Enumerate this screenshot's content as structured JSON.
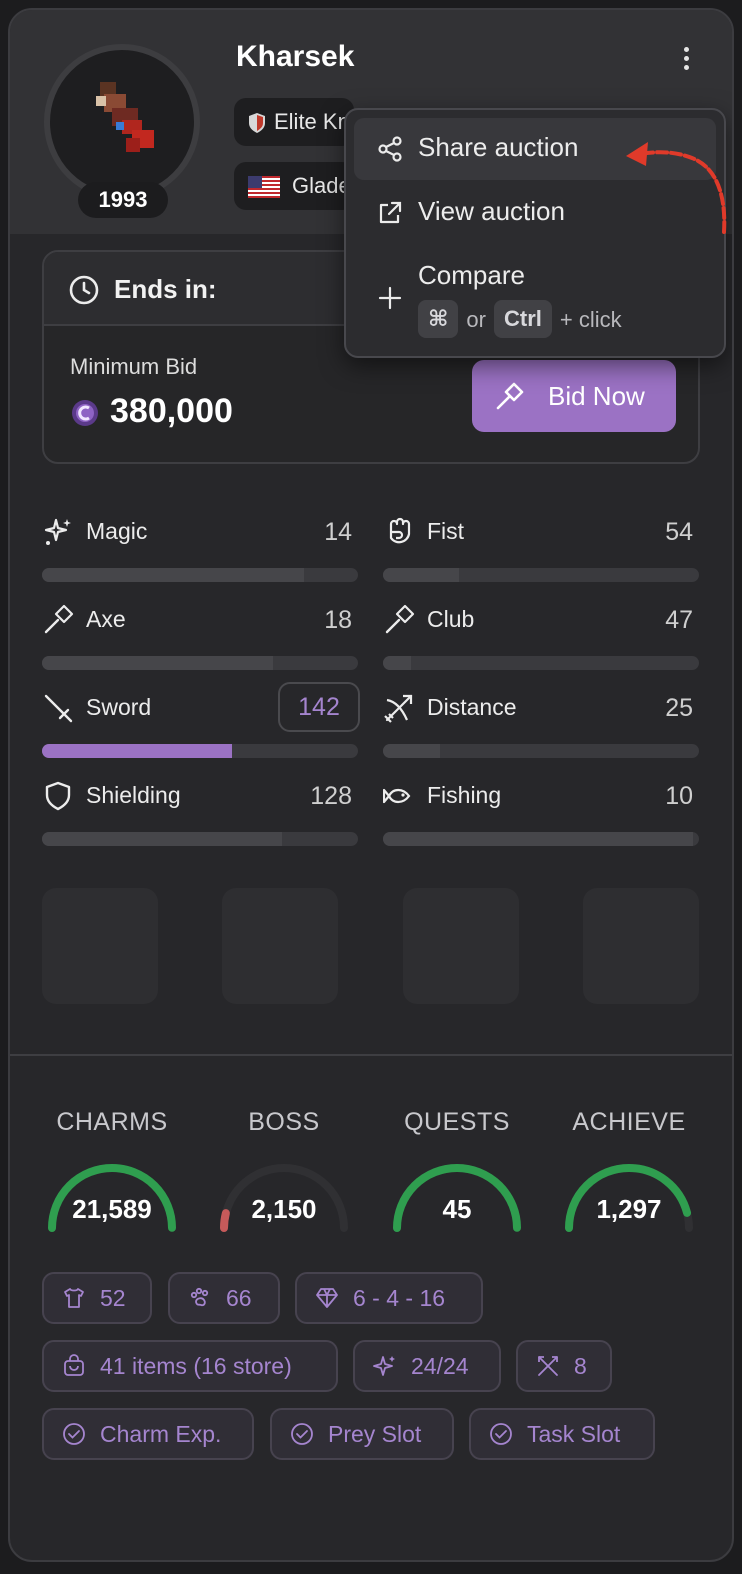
{
  "character": {
    "name": "Kharsek",
    "level": "1993",
    "vocation": "Elite Knight",
    "world": "Gladera",
    "vocation_icon": "shield-icon",
    "flag_icon": "us-flag-icon"
  },
  "menu": {
    "share_label": "Share auction",
    "view_label": "View auction",
    "compare_label": "Compare",
    "compare_hint": {
      "cmd": "⌘",
      "or": "or",
      "ctrl": "Ctrl",
      "click": "+ click"
    }
  },
  "auction": {
    "ends_label": "Ends in:",
    "min_bid_label": "Minimum Bid",
    "min_bid_value": "380,000",
    "bid_button_label": "Bid Now"
  },
  "skills": [
    {
      "name": "Magic",
      "value": "14",
      "progress": 0.83,
      "icon": "sparkles-icon"
    },
    {
      "name": "Fist",
      "value": "54",
      "progress": 0.24,
      "icon": "fist-icon"
    },
    {
      "name": "Axe",
      "value": "18",
      "progress": 0.73,
      "icon": "axe-icon"
    },
    {
      "name": "Club",
      "value": "47",
      "progress": 0.09,
      "icon": "club-icon"
    },
    {
      "name": "Sword",
      "value": "142",
      "progress": 0.6,
      "icon": "sword-icon",
      "highlight": true
    },
    {
      "name": "Distance",
      "value": "25",
      "progress": 0.18,
      "icon": "distance-icon"
    },
    {
      "name": "Shielding",
      "value": "128",
      "progress": 0.76,
      "icon": "shield-outline-icon"
    },
    {
      "name": "Fishing",
      "value": "10",
      "progress": 0.98,
      "icon": "fish-icon"
    }
  ],
  "stats": [
    {
      "label": "CHARMS",
      "value": "21,589",
      "fill": 1.0,
      "color": "#2f9e4f"
    },
    {
      "label": "BOSS",
      "value": "2,150",
      "fill": 0.08,
      "color": "#c65a5a"
    },
    {
      "label": "QUESTS",
      "value": "45",
      "fill": 1.0,
      "color": "#2f9e4f"
    },
    {
      "label": "ACHIEVE",
      "value": "1,297",
      "fill": 0.92,
      "color": "#2f9e4f"
    }
  ],
  "chips": {
    "outfits": "52",
    "mounts": "66",
    "gems": "6 - 4 - 16",
    "items": "41 items (16 store)",
    "charms": "24/24",
    "hunting": "8",
    "charm_exp": "Charm Exp.",
    "prey_slot": "Prey Slot",
    "task_slot": "Task Slot"
  },
  "colors": {
    "accent": "#9b72c4",
    "accent_text": "#a585cf",
    "good": "#2f9e4f",
    "bad": "#c65a5a",
    "annotation": "#e03a2a"
  }
}
